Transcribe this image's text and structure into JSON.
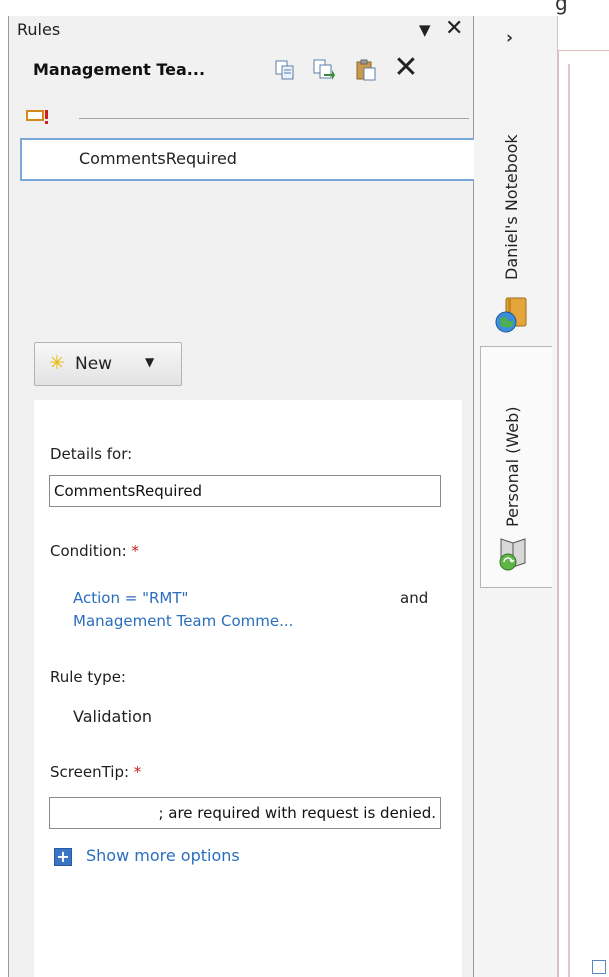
{
  "pane": {
    "title": "Rules",
    "menu_glyph": "▼",
    "close_glyph": "✕",
    "rule_set_title": "Management Tea...",
    "toolbar": {
      "delete_glyph": "✕"
    }
  },
  "rules": {
    "items": [
      {
        "label": "CommentsRequired",
        "selected": true
      }
    ]
  },
  "new_button": {
    "label": "New",
    "icon_glyph": "✳",
    "caret": "▼"
  },
  "details": {
    "details_label": "Details for:",
    "details_value": "CommentsRequired",
    "condition_label": "Condition:",
    "required_marker": "*",
    "condition_part1": "Action = \"RMT\"",
    "condition_and": "and",
    "condition_part2": "Management Team Comme...",
    "rule_type_label": "Rule type:",
    "rule_type_value": "Validation",
    "screentip_label": "ScreenTip:",
    "screentip_value": "; are required with request is denied.",
    "more_plus": "+",
    "more_options": "Show more options"
  },
  "notebooks": {
    "expand_glyph": "›",
    "items": [
      {
        "label": "Daniel's Notebook",
        "icon": "notebook-icon"
      },
      {
        "label": "Personal (Web)",
        "icon": "web-notebook-icon"
      }
    ]
  },
  "top_cut_text": "g",
  "colors": {
    "accent_link": "#2a6ebd",
    "selection_border": "#7aa8d8",
    "required": "#c41e1e"
  }
}
